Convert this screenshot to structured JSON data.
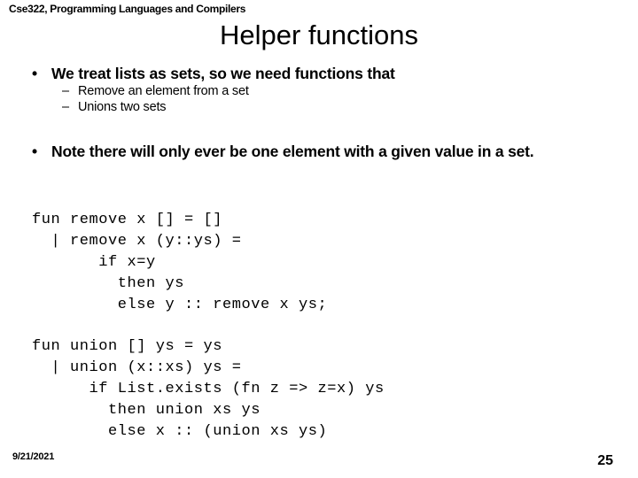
{
  "slide": {
    "header": "Cse322, Programming Languages and Compilers",
    "title": "Helper functions"
  },
  "bullets": [
    {
      "level": 1,
      "marker": "•",
      "text": "We treat lists as sets, so we need functions that"
    },
    {
      "level": 2,
      "marker": "–",
      "text": "Remove an element from a set"
    },
    {
      "level": 2,
      "marker": "–",
      "text": "Unions two sets"
    },
    {
      "level": 1,
      "marker": "•",
      "text": "Note there will only ever be one element with a given value in a set."
    }
  ],
  "code": {
    "remove": "fun remove x [] = []\n  | remove x (y::ys) =\n       if x=y\n         then ys\n         else y :: remove x ys;",
    "union": "fun union [] ys = ys\n  | union (x::xs) ys =\n      if List.exists (fn z => z=x) ys\n        then union xs ys\n        else x :: (union xs ys)"
  },
  "footer": {
    "date": "9/21/2021",
    "page_number": "25"
  },
  "colors": {
    "background": "#ffffff",
    "text": "#000000"
  }
}
